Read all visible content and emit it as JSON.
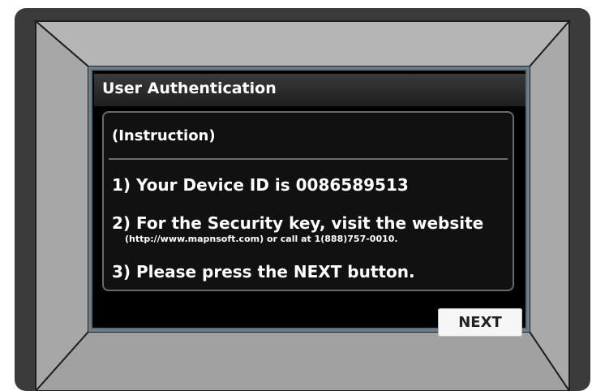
{
  "dialog": {
    "title": "User Authentication",
    "heading": "(Instruction)",
    "items": [
      "1) Your Device ID is 0086589513",
      "2) For the Security key, visit the website",
      "(http://www.mapnsoft.com) or call at 1(888)757-0010.",
      "3) Please press the NEXT button."
    ],
    "next_label": "NEXT"
  }
}
